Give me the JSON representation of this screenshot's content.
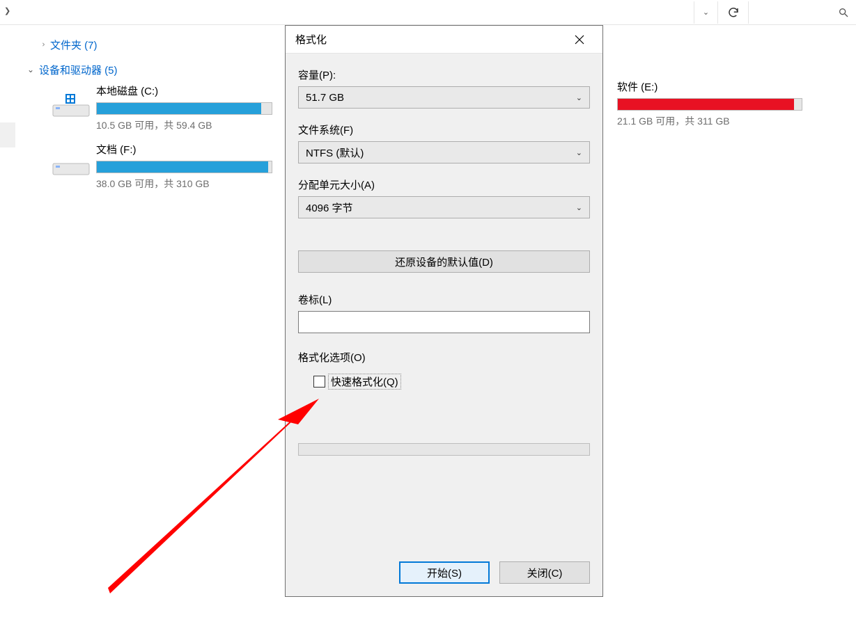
{
  "toolbar": {
    "dropdown_glyph": "⌄",
    "refresh_glyph": "↻",
    "search_glyph": "🔍"
  },
  "explorer": {
    "folders_group": "文件夹 (7)",
    "devices_group": "设备和驱动器 (5)",
    "drives": {
      "c": {
        "title": "本地磁盘 (C:)",
        "sub": "10.5 GB 可用，共 59.4 GB",
        "fill_pct": 94
      },
      "e": {
        "title": "软件 (E:)",
        "sub": "21.1 GB 可用，共 311 GB",
        "fill_pct": 96
      },
      "f": {
        "title": "文档 (F:)",
        "sub": "38.0 GB 可用，共 310 GB",
        "fill_pct": 98
      }
    }
  },
  "dialog": {
    "title": "格式化",
    "capacity_label": "容量(P):",
    "capacity_value": "51.7 GB",
    "filesystem_label": "文件系统(F)",
    "filesystem_value": "NTFS (默认)",
    "alloc_label": "分配单元大小(A)",
    "alloc_value": "4096 字节",
    "restore_defaults": "还原设备的默认值(D)",
    "volume_label": "卷标(L)",
    "volume_value": "",
    "options_legend": "格式化选项(O)",
    "quick_format": "快速格式化(Q)",
    "start": "开始(S)",
    "close": "关闭(C)"
  }
}
